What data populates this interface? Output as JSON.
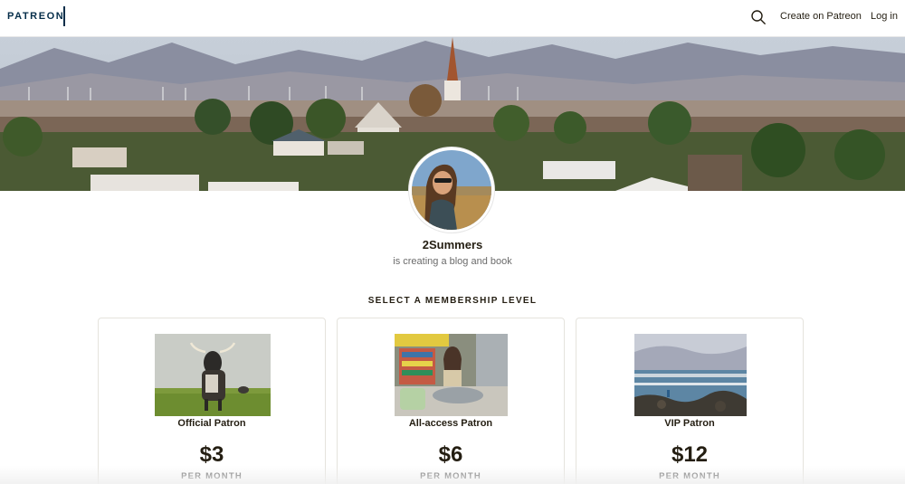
{
  "nav": {
    "logo_text": "PATREON",
    "search_icon": "search-icon",
    "create_label": "Create on Patreon",
    "login_label": "Log in"
  },
  "creator": {
    "name": "2Summers",
    "description": "is creating a blog and book"
  },
  "membership": {
    "section_title": "SELECT A MEMBERSHIP LEVEL",
    "tiers": [
      {
        "name": "Official Patron",
        "price": "$3",
        "period": "PER MONTH"
      },
      {
        "name": "All-access Patron",
        "price": "$6",
        "period": "PER MONTH"
      },
      {
        "name": "VIP Patron",
        "price": "$12",
        "period": "PER MONTH"
      }
    ]
  },
  "colors": {
    "brand_navy": "#052d49",
    "text_dark": "#241e12",
    "text_muted": "#6b6b6b"
  }
}
